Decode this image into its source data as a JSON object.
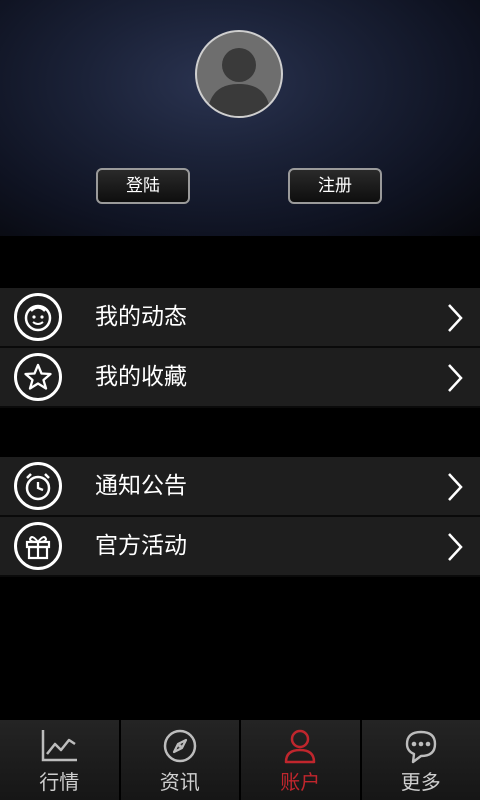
{
  "header": {
    "login_label": "登陆",
    "register_label": "注册"
  },
  "menu_groups": [
    {
      "items": [
        {
          "label": "我的动态",
          "icon": "face-icon"
        },
        {
          "label": "我的收藏",
          "icon": "star-icon"
        }
      ]
    },
    {
      "items": [
        {
          "label": "通知公告",
          "icon": "alarm-clock-icon"
        },
        {
          "label": "官方活动",
          "icon": "gift-icon"
        }
      ]
    }
  ],
  "tabbar": {
    "items": [
      {
        "label": "行情",
        "icon": "chart-icon"
      },
      {
        "label": "资讯",
        "icon": "compass-icon"
      },
      {
        "label": "账户",
        "icon": "user-icon",
        "active": true
      },
      {
        "label": "更多",
        "icon": "more-icon"
      }
    ],
    "active_color": "#c0262d"
  }
}
